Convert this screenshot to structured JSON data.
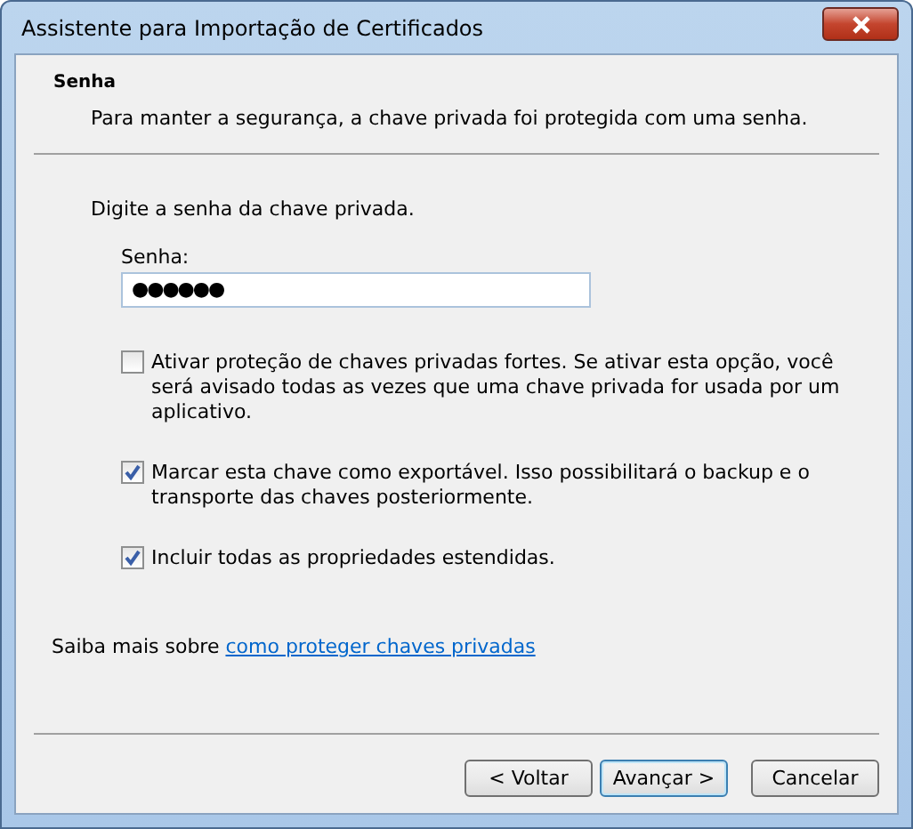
{
  "window": {
    "title": "Assistente para Importação de Certificados"
  },
  "header": {
    "title": "Senha",
    "subtitle": "Para manter a segurança, a chave privada foi protegida com uma senha."
  },
  "prompt": "Digite a senha da chave privada.",
  "password": {
    "label": "Senha:",
    "value": "●●●●●●"
  },
  "options": [
    {
      "label": "Ativar proteção de chaves privadas fortes. Se ativar esta opção, você será avisado todas as vezes que uma chave privada for usada por um aplicativo.",
      "checked": false
    },
    {
      "label": "Marcar esta chave como exportável. Isso possibilitará o backup e o transporte das chaves posteriormente.",
      "checked": true
    },
    {
      "label": "Incluir todas as propriedades estendidas.",
      "checked": true
    }
  ],
  "learn_more": {
    "text": "Saiba mais sobre",
    "link": "como proteger chaves privadas"
  },
  "buttons": [
    {
      "label": "< Voltar",
      "default": false
    },
    {
      "label": "Avançar >",
      "default": true
    },
    {
      "label": "Cancelar",
      "default": false
    }
  ]
}
